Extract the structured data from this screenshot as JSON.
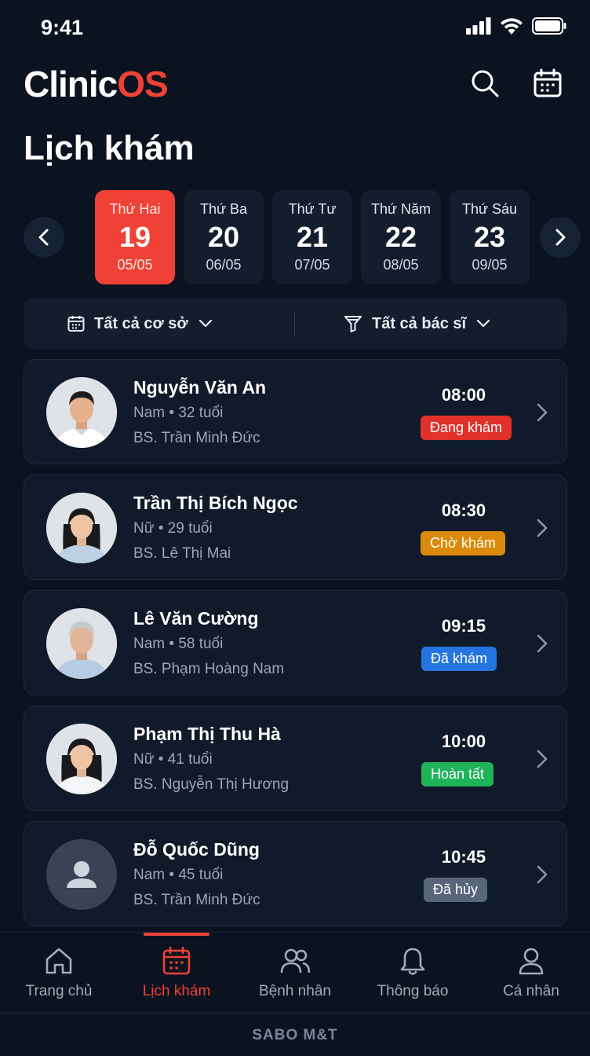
{
  "status_bar": {
    "time": "9:41"
  },
  "header": {
    "logo_clinic": "Clinic",
    "logo_os": "OS",
    "search_icon": "search-icon",
    "calendar_icon": "calendar-icon"
  },
  "page_title": "Lịch khám",
  "week": {
    "days": [
      {
        "name": "Thứ Hai",
        "num": "19",
        "date": "05/05",
        "active": true
      },
      {
        "name": "Thứ Ba",
        "num": "20",
        "date": "06/05",
        "active": false
      },
      {
        "name": "Thứ Tư",
        "num": "21",
        "date": "07/05",
        "active": false
      },
      {
        "name": "Thứ Năm",
        "num": "22",
        "date": "08/05",
        "active": false
      },
      {
        "name": "Thứ Sáu",
        "num": "23",
        "date": "09/05",
        "active": false
      }
    ]
  },
  "filters": {
    "facility": "Tất cả cơ sở",
    "doctor": "Tất cả bác sĩ"
  },
  "appointments": [
    {
      "name": "Nguyễn Văn An",
      "info": "Nam • 32 tuổi",
      "doctor": "BS. Trần Minh Đức",
      "time": "08:00",
      "status": "Đang khám",
      "status_color": "#e0322a"
    },
    {
      "name": "Trần Thị Bích Ngọc",
      "info": "Nữ • 29 tuổi",
      "doctor": "BS. Lê Thị Mai",
      "time": "08:30",
      "status": "Chờ khám",
      "status_color": "#d98a0b"
    },
    {
      "name": "Lê Văn Cường",
      "info": "Nam • 58 tuổi",
      "doctor": "BS. Phạm Hoàng Nam",
      "time": "09:15",
      "status": "Đã khám",
      "status_color": "#2475e0"
    },
    {
      "name": "Phạm Thị Thu Hà",
      "info": "Nữ • 41 tuổi",
      "doctor": "BS. Nguyễn Thị Hương",
      "time": "10:00",
      "status": "Hoàn tất",
      "status_color": "#1fb35a"
    },
    {
      "name": "Đỗ Quốc Dũng",
      "info": "Nam • 45 tuổi",
      "doctor": "BS. Trần Minh Đức",
      "time": "10:45",
      "status": "Đã hủy",
      "status_color": "#59657a"
    }
  ],
  "bottom_nav": {
    "tabs": [
      {
        "label": "Trang chủ",
        "icon": "home-icon"
      },
      {
        "label": "Lịch khám",
        "icon": "calendar-icon"
      },
      {
        "label": "Bệnh nhân",
        "icon": "users-icon"
      },
      {
        "label": "Thông báo",
        "icon": "bell-icon"
      },
      {
        "label": "Cá nhân",
        "icon": "user-icon"
      }
    ],
    "active_index": 1
  },
  "footer": "SABO M&T",
  "colors": {
    "accent": "#ef4136",
    "background": "#0b1220",
    "card": "#111a2a"
  }
}
